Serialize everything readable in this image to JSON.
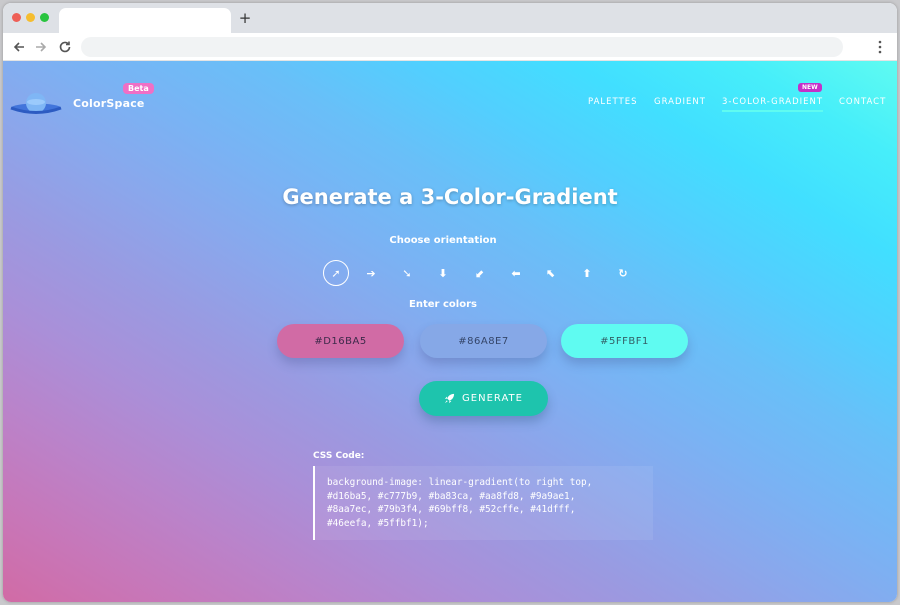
{
  "browser": {
    "new_tab_symbol": "+"
  },
  "site": {
    "brand": "ColorSpace",
    "beta_badge": "Beta",
    "new_badge": "NEW",
    "nav": [
      {
        "label": "PALETTES"
      },
      {
        "label": "GRADIENT"
      },
      {
        "label": "3-COLOR-GRADIENT",
        "active": true
      },
      {
        "label": "CONTACT"
      }
    ]
  },
  "main": {
    "title": "Generate a 3-Color-Gradient",
    "orientation_label": "Choose orientation",
    "orientations": [
      {
        "icon": "arrow-up-right-icon",
        "glyph": "➚",
        "active": true
      },
      {
        "icon": "arrow-right-icon",
        "glyph": "➔"
      },
      {
        "icon": "arrow-down-right-icon",
        "glyph": "➘"
      },
      {
        "icon": "arrow-down-icon",
        "glyph": "⬇"
      },
      {
        "icon": "arrow-down-left-icon",
        "glyph": "⬋"
      },
      {
        "icon": "arrow-left-icon",
        "glyph": "⬅"
      },
      {
        "icon": "arrow-up-left-icon",
        "glyph": "⬉"
      },
      {
        "icon": "arrow-up-icon",
        "glyph": "⬆"
      },
      {
        "icon": "radial-icon",
        "glyph": "↻"
      }
    ],
    "colors_label": "Enter colors",
    "colors": [
      {
        "value": "#D16BA5",
        "hex": "#d16ba5"
      },
      {
        "value": "#86A8E7",
        "hex": "#86a8e7"
      },
      {
        "value": "#5FFBF1",
        "hex": "#5ffbf1"
      }
    ],
    "generate_label": "GENERATE",
    "css_label": "CSS Code:",
    "css_code": "background-image: linear-gradient(to right top,\n#d16ba5, #c777b9, #ba83ca, #aa8fd8, #9a9ae1,\n#8aa7ec, #79b3f4, #69bff8, #52cffe, #41dfff,\n#46eefa, #5ffbf1);"
  }
}
